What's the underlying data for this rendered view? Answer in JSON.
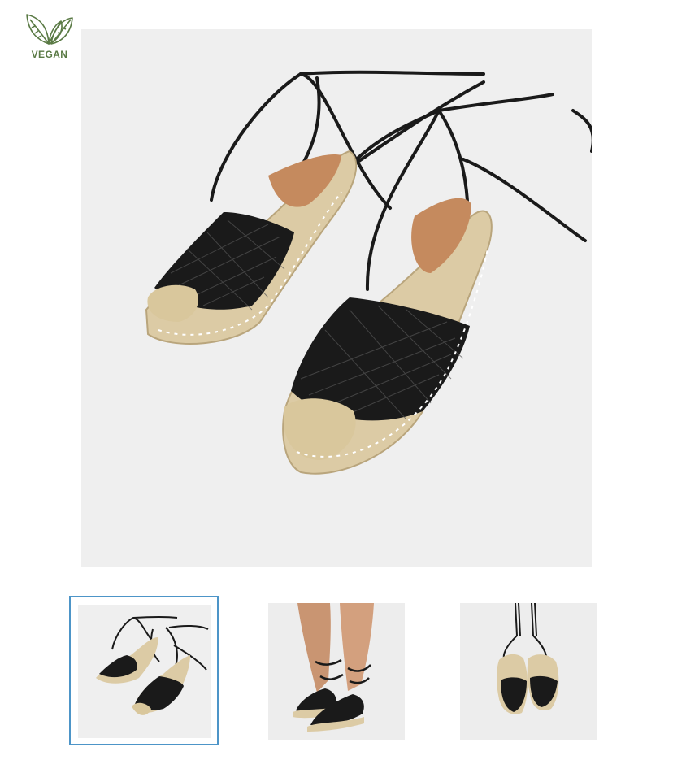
{
  "badge": {
    "label": "VEGAN",
    "icon": "leaves-icon",
    "color": "#5a7a45"
  },
  "gallery": {
    "main_image": {
      "description_icon": "espadrille-sandals-image"
    },
    "thumbnails": [
      {
        "icon": "espadrille-pair-thumbnail",
        "selected": true
      },
      {
        "icon": "espadrille-worn-thumbnail",
        "selected": false
      },
      {
        "icon": "espadrille-hanging-thumbnail",
        "selected": false
      }
    ],
    "selected_border_color": "#4d95c8"
  }
}
